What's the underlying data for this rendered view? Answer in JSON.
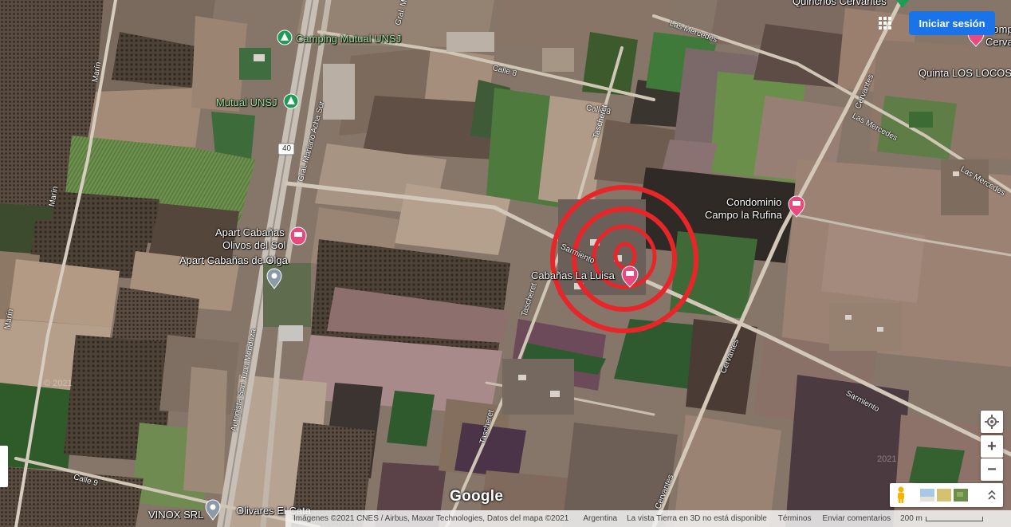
{
  "header": {
    "signin_label": "Iniciar sesión"
  },
  "places": {
    "camping": "Camping Mutual UNSJ",
    "mutual": "Mutual UNSJ",
    "quinchos": "Quinchos Cervantes",
    "complejo": "Comp",
    "complejo2": "Cerva",
    "quinta": "Quinta LOS LOCOS",
    "condominio_1": "Condominio",
    "condominio_2": "Campo la Rufina",
    "apart_olivos_1": "Apart Cabañas",
    "apart_olivos_2": "Olivos del Sol",
    "apart_olga": "Apart Cabañas de Olga",
    "cabanas_luisa": "Cabañas La Luisa",
    "vinox": "VINOX SRL",
    "olivares": "Olivares El Cata"
  },
  "roads": {
    "marin_1": "Marín",
    "marin_2": "Marín",
    "marin_3": "Marín",
    "gral_acha": "Gral. Mariano Acha Sur",
    "gral_top": "Gral. M",
    "route": "40",
    "autopista": "Autopista San Juan Mendoza",
    "calle8_a": "Calle 8",
    "calle8_b": "Calle 8",
    "calle9": "Calle 9",
    "taschereau_1": "Tascheret",
    "taschereau_2": "Tascheret",
    "taschereau_3": "Tascheret",
    "sarmiento_1": "Sarmiento",
    "sarmiento_2": "Sarmiento",
    "cervantes_1": "Cervantes",
    "cervantes_2": "Cervantes",
    "cervantes_3": "Cervantes",
    "mercedes_1": "Las Mercedes",
    "mercedes_2": "Las Mercedes",
    "mercedes_3": "Las Mercedes"
  },
  "footer": {
    "imagery": "Imágenes ©2021 CNES / Airbus, Maxar Technologies, Datos del mapa ©2021",
    "country": "Argentina",
    "no3d": "La vista Tierra en 3D no está disponible",
    "terms": "Términos",
    "feedback": "Enviar comentarios",
    "scale": "200 m"
  },
  "watermark": {
    "google": "Google",
    "year_1": "© 2021",
    "year_2": "2021"
  },
  "controls": {
    "zoom_in": "+",
    "zoom_out": "−"
  },
  "colors": {
    "accent": "#1a73e8",
    "marker_red": "#e8262a",
    "pin_pink": "#e84a7f",
    "park_green": "#1e9c57"
  }
}
